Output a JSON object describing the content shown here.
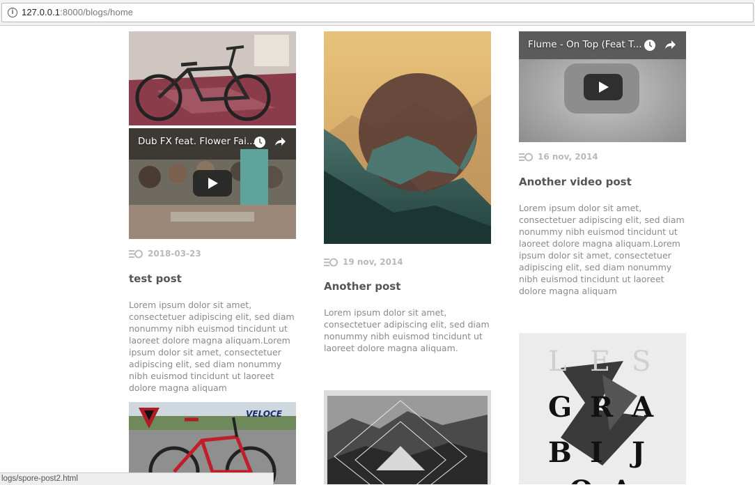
{
  "browser": {
    "url_host": "127.0.0.1",
    "url_path": ":8000/blogs/home",
    "status_text": "logs/spore-post2.html"
  },
  "posts": {
    "test_post": {
      "video_title": "Dub FX feat. Flower Fai...",
      "date": "2018-03-23",
      "title": "test post",
      "excerpt": "Lorem ipsum dolor sit amet, consectetuer adipiscing elit, sed diam nonummy nibh euismod tincidunt ut laoreet dolore magna aliquam.Lorem ipsum dolor sit amet, consectetuer adipiscing elit, sed diam nonummy nibh euismod tincidunt ut laoreet dolore magna aliquam"
    },
    "another_post": {
      "date": "19 nov, 2014",
      "title": "Another post",
      "excerpt": "Lorem ipsum dolor sit amet, consectetuer adipiscing elit, sed diam nonummy nibh euismod tincidunt ut laoreet dolore magna aliquam."
    },
    "another_video_post": {
      "video_title": "Flume - On Top (Feat T...",
      "date": "16 nov, 2014",
      "title": "Another video post",
      "excerpt": "Lorem ipsum dolor sit amet, consectetuer adipiscing elit, sed diam nonummy nibh euismod tincidunt ut laoreet dolore magna aliquam.Lorem ipsum dolor sit amet, consectetuer adipiscing elit, sed diam nonummy nibh euismod tincidunt ut laoreet dolore magna aliquam"
    },
    "bike_brand": "VELOCE",
    "poster_letters": [
      "L",
      "E",
      "S",
      "G",
      "R",
      "A",
      "B",
      "I",
      "J",
      "O",
      "A"
    ]
  },
  "colors": {
    "meta_gray": "#b9b9b9",
    "title_gray": "#555555",
    "body_gray": "#8a8a8a"
  }
}
